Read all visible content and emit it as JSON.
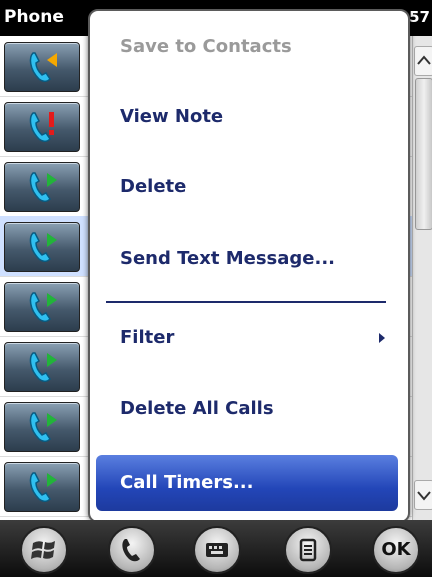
{
  "title_bar": {
    "app_title": "Phone",
    "clock": "57"
  },
  "call_list": {
    "rows": [
      {
        "type": "outgoing",
        "icon": "call-outgoing-icon",
        "accent": "#f5a800"
      },
      {
        "type": "missed",
        "icon": "call-missed-icon",
        "accent": "#e31b1b"
      },
      {
        "type": "incoming",
        "icon": "call-incoming-icon",
        "accent": "#22b33a"
      },
      {
        "type": "incoming",
        "icon": "call-incoming-icon",
        "accent": "#22b33a",
        "selected": true
      },
      {
        "type": "incoming",
        "icon": "call-incoming-icon",
        "accent": "#22b33a"
      },
      {
        "type": "incoming",
        "icon": "call-incoming-icon",
        "accent": "#22b33a"
      },
      {
        "type": "incoming",
        "icon": "call-incoming-icon",
        "accent": "#22b33a"
      },
      {
        "type": "incoming",
        "icon": "call-incoming-icon",
        "accent": "#22b33a"
      }
    ]
  },
  "context_menu": {
    "items": [
      {
        "label": "Save to Contacts",
        "state": "disabled"
      },
      {
        "label": "View Note"
      },
      {
        "label": "Delete"
      },
      {
        "label": "Send Text Message..."
      },
      {
        "label": "Filter",
        "submenu": true
      },
      {
        "label": "Delete All Calls"
      },
      {
        "label": "Call Timers...",
        "state": "highlighted"
      }
    ]
  },
  "soft_keys": {
    "start": {
      "icon": "windows-start-icon"
    },
    "phone": {
      "icon": "phone-icon"
    },
    "keyboard": {
      "icon": "keyboard-icon"
    },
    "menu": {
      "icon": "menu-list-icon"
    },
    "ok": {
      "label": "OK"
    }
  },
  "colors": {
    "menu_text": "#1d2a6b",
    "highlight": "#2346b8",
    "disabled_text": "#9a9a9a"
  }
}
